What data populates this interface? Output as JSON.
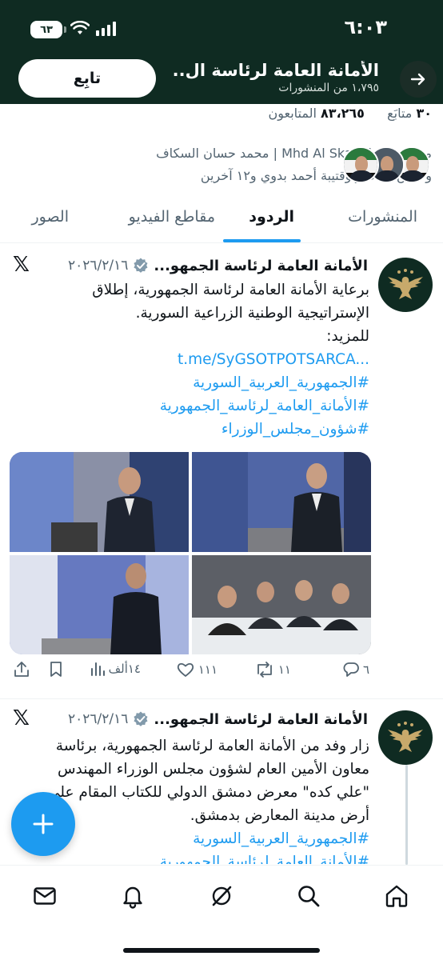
{
  "status_bar": {
    "time": "٦:٠٣",
    "battery": "٦٣"
  },
  "header": {
    "title": "الأمانة العامة لرئاسة ال...",
    "subtitle": "١،٧٩٥ من المنشورات",
    "follow_label": "تابِع"
  },
  "profile": {
    "following_count": "٣٠",
    "following_label": "متابَع",
    "followers_count": "٨٣،٢٦٥",
    "followers_label": "المتابعون",
    "followed_by_line1": "متابَع بواسطة Mhd Al Skaf | محمد حسان السكاف",
    "followed_by_line2": "وحسن المختار وقتيبة أحمد بدوي و١٢ آخرين"
  },
  "tabs": [
    {
      "label": "المنشورات",
      "active": false
    },
    {
      "label": "الردود",
      "active": true
    },
    {
      "label": "مقاطع الفيديو",
      "active": false
    },
    {
      "label": "الصور",
      "active": false
    }
  ],
  "posts": [
    {
      "author": "الأمانة العامة لرئاسة الجمهو...",
      "date": "٢٠٢٦/٢/١٦",
      "text_lines": [
        "برعاية الأمانة العامة لرئاسة الجمهورية، إطلاق",
        "الإستراتيجية الوطنية الزراعية السورية.",
        "للمزيد:"
      ],
      "link": "t.me/SyGSOTPOTSARCA...",
      "hashtags": [
        "#الجمهورية_العربية_السورية",
        "#الأمانة_العامة_لرئاسة_الجمهورية",
        "#شؤون_مجلس_الوزراء"
      ],
      "replies": "٦",
      "reposts": "١١",
      "likes": "١١١",
      "views": "١٤ألف"
    },
    {
      "author": "الأمانة العامة لرئاسة الجمهو...",
      "date": "٢٠٢٦/٢/١٦",
      "text_lines": [
        "زار وفد من الأمانة العامة لرئاسة الجمهورية، برئاسة",
        "معاون الأمين العام لشؤون مجلس الوزراء المهندس",
        "\"علي كده\" معرض دمشق الدولي للكتاب المقام على",
        "أرض مدينة المعارض بدمشق."
      ],
      "hashtags": [
        "#الجمهورية_العربية_السورية",
        "#الأمانة_العامة_لرئاسة_الجمهورية"
      ]
    }
  ],
  "nav": [
    "home-icon",
    "search-icon",
    "grok-icon",
    "notifications-icon",
    "messages-icon"
  ],
  "colors": {
    "header_bg": "#0f2b22",
    "accent": "#1d9bf0",
    "gold": "#c7a96b"
  }
}
